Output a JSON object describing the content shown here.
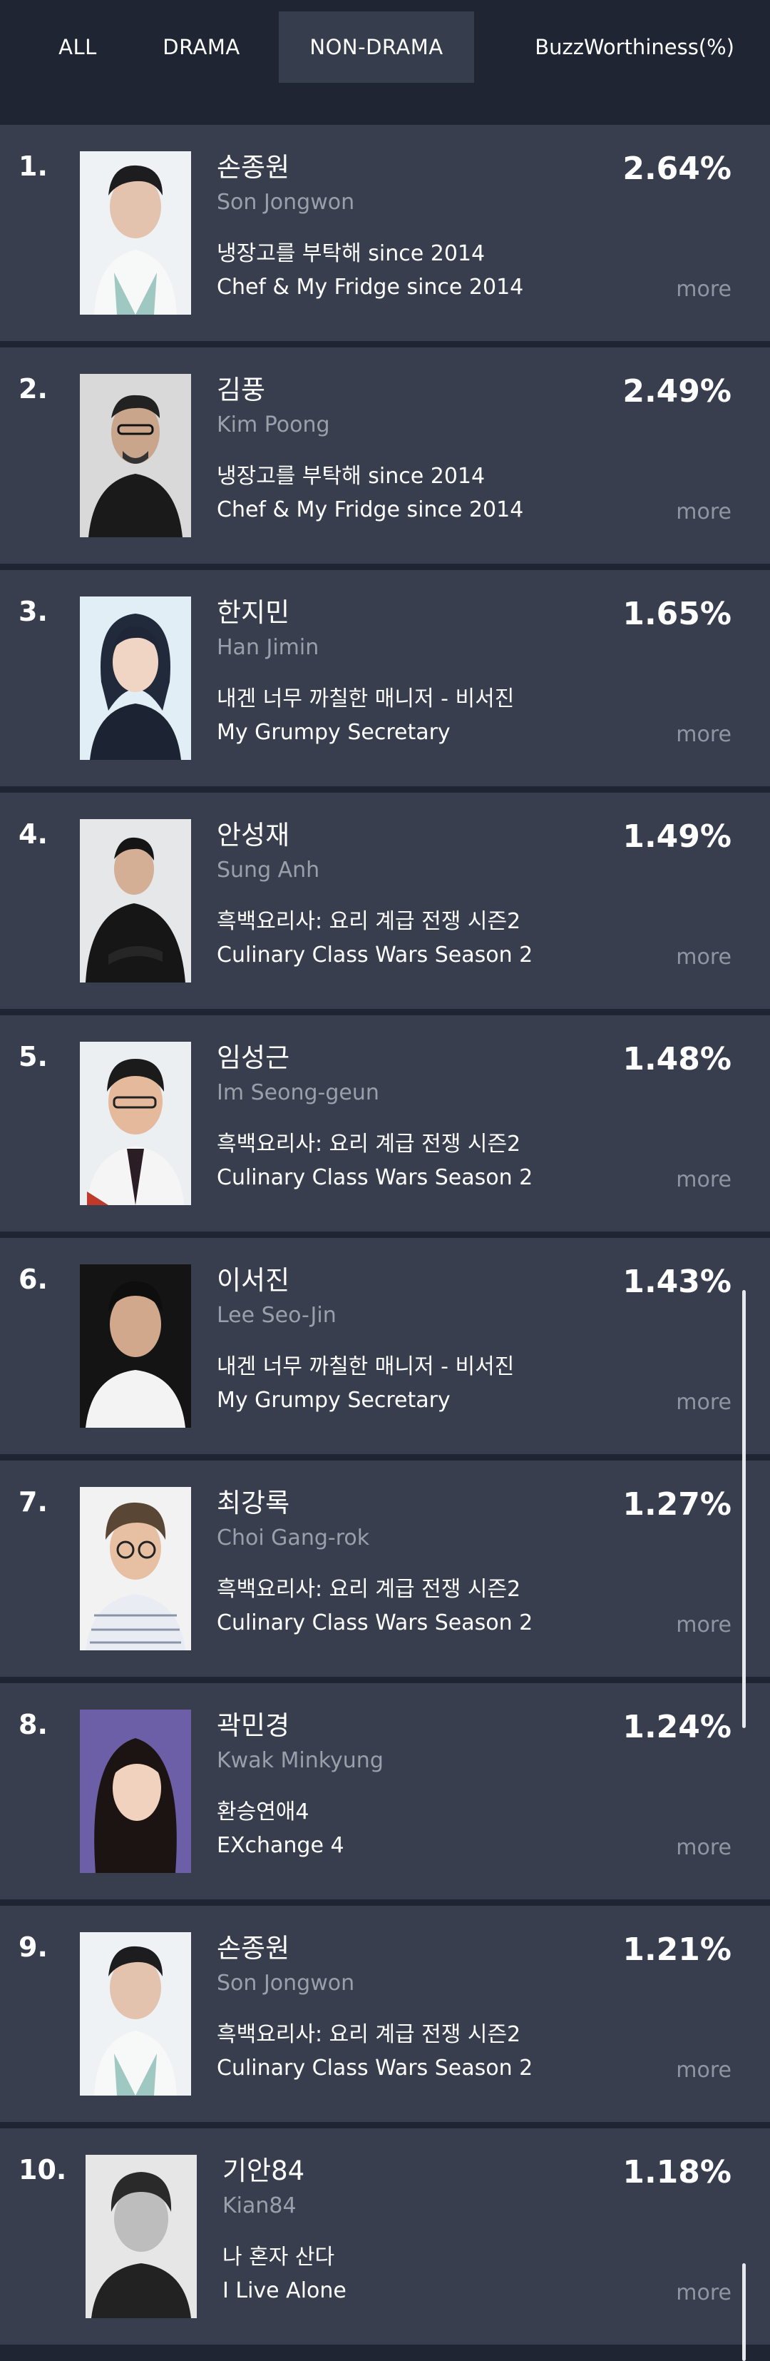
{
  "tabs": [
    {
      "label": "ALL"
    },
    {
      "label": "DRAMA"
    },
    {
      "label": "NON-DRAMA",
      "active": true
    }
  ],
  "metric_label": "BuzzWorthiness(%)",
  "more_label": "more",
  "colors": {
    "background": "#1f2533",
    "row": "#383e4d",
    "active_tab": "#363d4c",
    "muted_text": "#9aa0ab"
  },
  "items": [
    {
      "rank": "1.",
      "name_ko": "손종원",
      "name_en": "Son Jongwon",
      "program_ko": "냉장고를 부탁해 since 2014",
      "program_en": "Chef & My Fridge since 2014",
      "pct": "2.64%"
    },
    {
      "rank": "2.",
      "name_ko": "김풍",
      "name_en": "Kim Poong",
      "program_ko": "냉장고를 부탁해 since 2014",
      "program_en": "Chef & My Fridge since 2014",
      "pct": "2.49%"
    },
    {
      "rank": "3.",
      "name_ko": "한지민",
      "name_en": "Han Jimin",
      "program_ko": "내겐 너무 까칠한 매니저 - 비서진",
      "program_en": "My Grumpy Secretary",
      "pct": "1.65%"
    },
    {
      "rank": "4.",
      "name_ko": "안성재",
      "name_en": "Sung Anh",
      "program_ko": "흑백요리사: 요리 계급 전쟁 시즌2",
      "program_en": "Culinary Class Wars Season 2",
      "pct": "1.49%"
    },
    {
      "rank": "5.",
      "name_ko": "임성근",
      "name_en": "Im Seong-geun",
      "program_ko": "흑백요리사: 요리 계급 전쟁 시즌2",
      "program_en": "Culinary Class Wars Season 2",
      "pct": "1.48%"
    },
    {
      "rank": "6.",
      "name_ko": "이서진",
      "name_en": "Lee Seo-Jin",
      "program_ko": "내겐 너무 까칠한 매니저 - 비서진",
      "program_en": "My Grumpy Secretary",
      "pct": "1.43%"
    },
    {
      "rank": "7.",
      "name_ko": "최강록",
      "name_en": "Choi Gang-rok",
      "program_ko": "흑백요리사: 요리 계급 전쟁 시즌2",
      "program_en": "Culinary Class Wars Season 2",
      "pct": "1.27%"
    },
    {
      "rank": "8.",
      "name_ko": "곽민경",
      "name_en": "Kwak Minkyung",
      "program_ko": "환승연애4",
      "program_en": "EXchange 4",
      "pct": "1.24%"
    },
    {
      "rank": "9.",
      "name_ko": "손종원",
      "name_en": "Son Jongwon",
      "program_ko": "흑백요리사: 요리 계급 전쟁 시즌2",
      "program_en": "Culinary Class Wars Season 2",
      "pct": "1.21%"
    },
    {
      "rank": "10.",
      "name_ko": "기안84",
      "name_en": "Kian84",
      "program_ko": "나 혼자 산다",
      "program_en": "I Live Alone",
      "pct": "1.18%"
    }
  ]
}
